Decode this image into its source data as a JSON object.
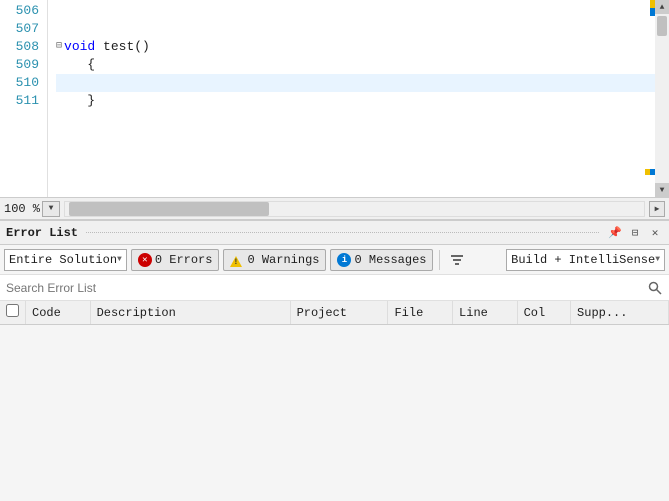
{
  "editor": {
    "lines": [
      {
        "num": "506",
        "content": "",
        "hasCollapse": false,
        "highlighted": false
      },
      {
        "num": "507",
        "content": "",
        "hasCollapse": false,
        "highlighted": false
      },
      {
        "num": "508",
        "content": "void test()",
        "hasCollapse": true,
        "highlighted": false,
        "keyword": "void"
      },
      {
        "num": "509",
        "content": "{",
        "hasCollapse": false,
        "highlighted": false
      },
      {
        "num": "510",
        "content": "",
        "hasCollapse": false,
        "highlighted": true
      },
      {
        "num": "511",
        "content": "}",
        "hasCollapse": false,
        "highlighted": false
      }
    ]
  },
  "zoom": {
    "label": "100 %",
    "dropdown_arrow": "▼",
    "scroll_right": "▶"
  },
  "error_list": {
    "title": "Error List",
    "pin_label": "📌",
    "float_label": "⊟",
    "close_label": "✕",
    "scope_options": [
      "Entire Solution"
    ],
    "scope_selected": "Entire Solution",
    "errors_label": "0 Errors",
    "warnings_label": "0 Warnings",
    "messages_label": "0 Messages",
    "build_option": "Build + IntelliSense",
    "search_placeholder": "Search Error List",
    "columns": [
      {
        "key": "checkbox",
        "label": ""
      },
      {
        "key": "code",
        "label": "Code"
      },
      {
        "key": "description",
        "label": "Description"
      },
      {
        "key": "project",
        "label": "Project"
      },
      {
        "key": "file",
        "label": "File"
      },
      {
        "key": "line",
        "label": "Line"
      },
      {
        "key": "col",
        "label": "Col"
      },
      {
        "key": "suppression",
        "label": "Supp..."
      }
    ],
    "rows": []
  },
  "icons": {
    "collapse": "⊟",
    "pin": "⊞",
    "auto_hide": "⊡",
    "close": "✕",
    "search": "🔍",
    "filter": "⊿"
  }
}
